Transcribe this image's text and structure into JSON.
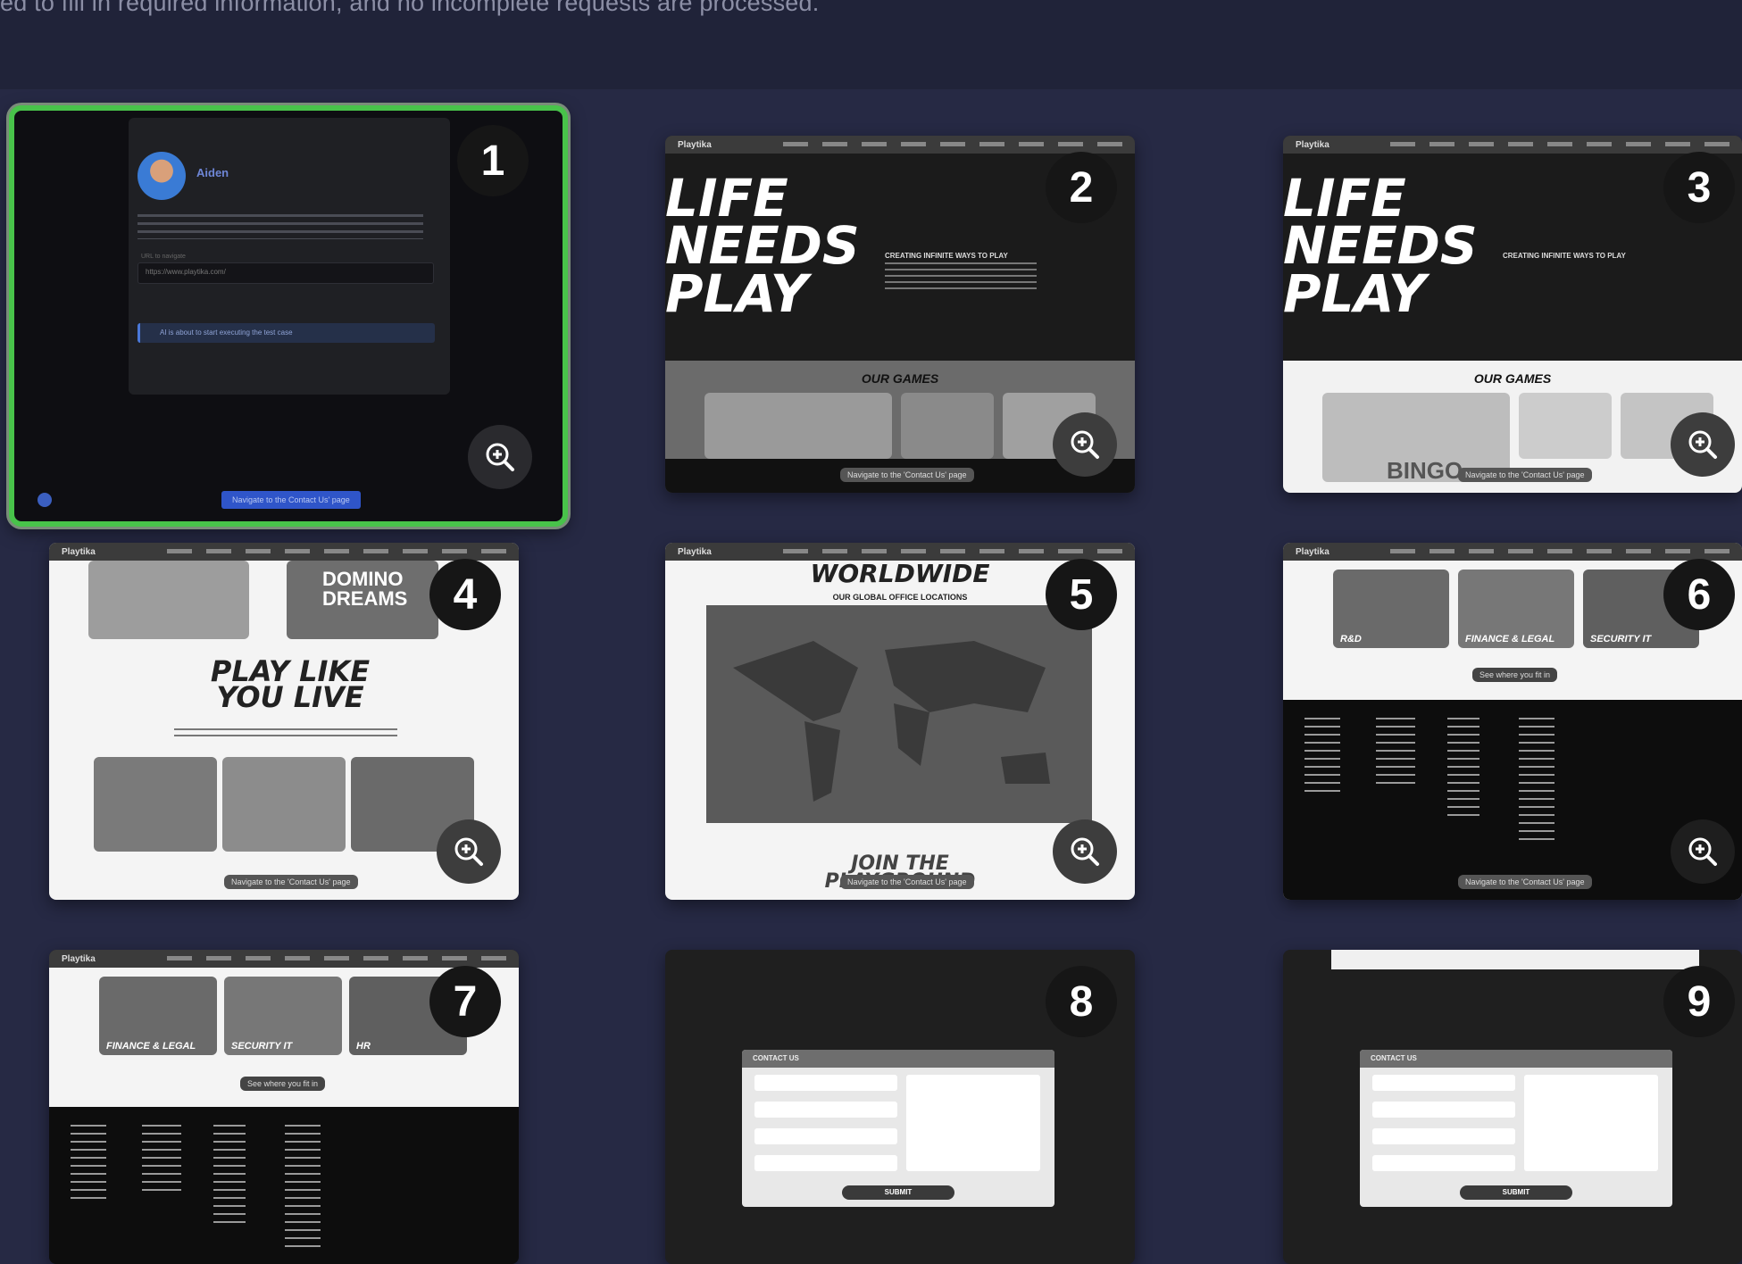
{
  "header": {
    "intro_text": "ed to fill in required information, and no incomplete requests are processed."
  },
  "thumbnails": [
    {
      "number": "1",
      "selected": true,
      "user_name": "Aiden",
      "url_label": "URL to navigate",
      "url_value": "https://www.playtika.com/",
      "status_text": "AI is about to start executing the test case",
      "action_label": "Navigate to the Contact Us' page"
    },
    {
      "number": "2",
      "hero": "LIFE NEEDS PLAY",
      "tagline": "CREATING INFINITE WAYS TO PLAY",
      "section": "OUR GAMES",
      "action_label": "Navigate to the 'Contact Us' page",
      "brand": "Playtika"
    },
    {
      "number": "3",
      "hero": "LIFE NEEDS PLAY",
      "tagline": "CREATING INFINITE WAYS TO PLAY",
      "section": "OUR GAMES",
      "action_label": "Navigate to the 'Contact Us' page",
      "brand": "Playtika",
      "game": "BINGO"
    },
    {
      "number": "4",
      "hero": "PLAY LIKE YOU LIVE",
      "game": "DOMINO DREAMS",
      "action_label": "Navigate to the 'Contact Us' page",
      "brand": "Playtika"
    },
    {
      "number": "5",
      "hero": "WORLDWIDE",
      "tagline": "OUR GLOBAL OFFICE LOCATIONS",
      "footer_heading": "JOIN THE PLAYGROUND",
      "action_label": "Navigate to the 'Contact Us' page",
      "brand": "Playtika"
    },
    {
      "number": "6",
      "tiles": [
        "R&D",
        "FINANCE & LEGAL",
        "SECURITY IT"
      ],
      "cta": "See where you fit in",
      "action_label": "Navigate to the 'Contact Us' page",
      "brand": "Playtika"
    },
    {
      "number": "7",
      "tiles": [
        "FINANCE & LEGAL",
        "SECURITY IT",
        "HR"
      ],
      "cta": "See where you fit in",
      "brand": "Playtika"
    },
    {
      "number": "8",
      "form_title": "CONTACT US",
      "submit_label": "SUBMIT"
    },
    {
      "number": "9",
      "form_title": "CONTACT US",
      "submit_label": "SUBMIT"
    }
  ],
  "colors": {
    "selected_border": "#48c34a",
    "background": "#262944",
    "header_band": "#202339"
  },
  "icons": {
    "zoom": "zoom-in-icon",
    "avatar": "avatar"
  }
}
